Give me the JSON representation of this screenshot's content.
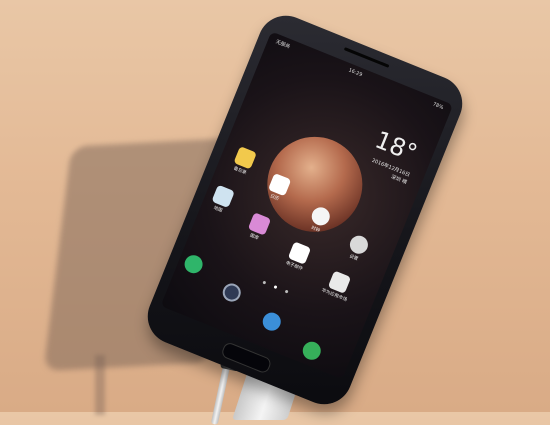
{
  "status_bar": {
    "carrier": "无服务",
    "time": "16:29",
    "battery": "78%"
  },
  "clock_widget": {
    "temperature": "18°",
    "date": "2016年12月16日",
    "location": "深圳 晴"
  },
  "apps": [
    {
      "label": "备忘录",
      "icon": "memo-icon",
      "color": "#f2c94c"
    },
    {
      "label": "日历",
      "icon": "calendar-icon",
      "color": "#ffffff"
    },
    {
      "label": "时钟",
      "icon": "clock-icon",
      "color": "#f5f5f5"
    },
    {
      "label": "设置",
      "icon": "settings-icon",
      "color": "#d9d9d9"
    },
    {
      "label": "地图",
      "icon": "map-icon",
      "color": "#cfe3f0"
    },
    {
      "label": "图库",
      "icon": "gallery-icon",
      "color": "#d98ad6"
    },
    {
      "label": "电子邮件",
      "icon": "email-icon",
      "color": "#ffffff"
    },
    {
      "label": "华为应用市场",
      "icon": "app-market-icon",
      "color": "#e9e9e9"
    }
  ],
  "dock": [
    {
      "icon": "phone-icon",
      "color": "#2fb56a"
    },
    {
      "icon": "camera-icon",
      "color": "#2f3a55"
    },
    {
      "icon": "browser-icon",
      "color": "#3b8fd8"
    },
    {
      "icon": "messages-icon",
      "color": "#36b05a"
    }
  ],
  "page_indicator": {
    "pages": 3,
    "active": 2
  }
}
